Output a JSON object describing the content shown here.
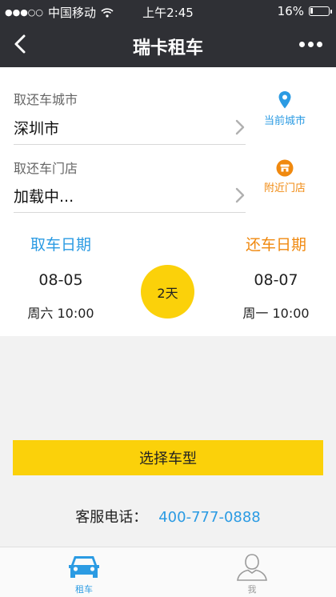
{
  "status_bar": {
    "signal_dots": "●●●○○",
    "carrier": "中国移动",
    "time": "上午2:45",
    "battery_percent": "16%",
    "battery_level": 0.16
  },
  "nav": {
    "title": "瑞卡租车"
  },
  "form": {
    "city_label": "取还车城市",
    "city_value": "深圳市",
    "current_city_label": "当前城市",
    "store_label": "取还车门店",
    "store_value": "加载中...",
    "nearby_store_label": "附近门店"
  },
  "dates": {
    "pickup_header": "取车日期",
    "pickup_date": "08-05",
    "pickup_weekday_time": "周六 10:00",
    "duration": "2天",
    "return_header": "还车日期",
    "return_date": "08-07",
    "return_weekday_time": "周一 10:00"
  },
  "actions": {
    "select_car_label": "选择车型"
  },
  "service": {
    "label": "客服电话：",
    "phone": "400-777-0888"
  },
  "tabs": [
    {
      "label": "租车",
      "icon": "car-icon",
      "active": true
    },
    {
      "label": "我",
      "icon": "person-icon",
      "active": false
    }
  ],
  "colors": {
    "nav_bg": "#2f3035",
    "accent_blue": "#2b9be3",
    "accent_orange": "#f0890f",
    "accent_yellow": "#fbd10a"
  }
}
